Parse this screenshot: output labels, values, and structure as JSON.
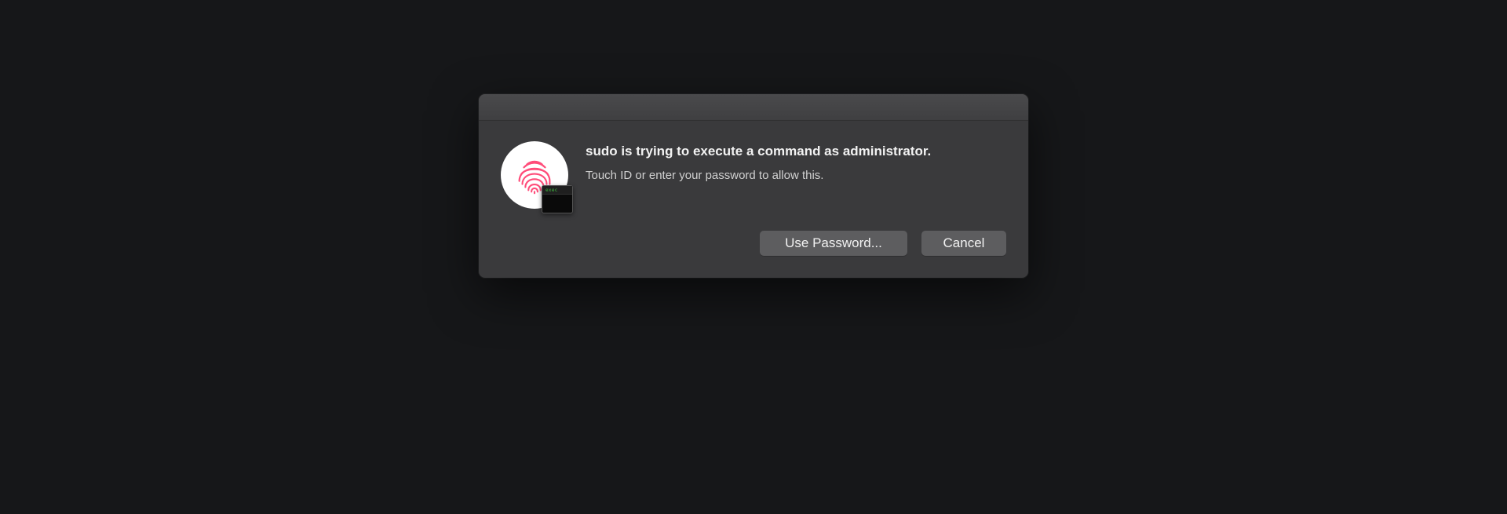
{
  "dialog": {
    "title": "sudo is trying to execute a command as administrator.",
    "subtitle": "Touch ID or enter your password to allow this.",
    "badge_text": "exec",
    "buttons": {
      "use_password": "Use Password...",
      "cancel": "Cancel"
    }
  }
}
